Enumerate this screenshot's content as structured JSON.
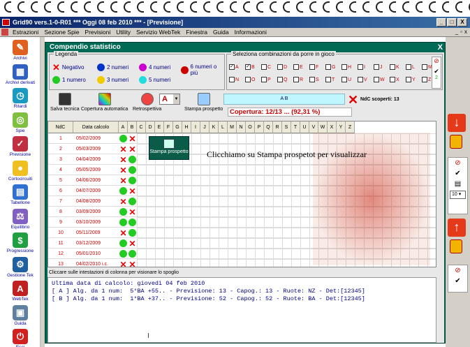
{
  "window": {
    "title": "Grid90 vers.1-0-R01  ***  Oggi 08 feb 2010  ***  - [Previsione]",
    "controls": [
      "_",
      "□",
      "X"
    ]
  },
  "menu": [
    "Estrazioni",
    "Sezione Spie",
    "Previsioni",
    "Utility",
    "Servizio WebTek",
    "Finestra",
    "Guida",
    "Informazioni"
  ],
  "sidebar": [
    {
      "label": "Archivi",
      "icon": "pencil-icon"
    },
    {
      "label": "Archivi derivati",
      "icon": "archive-icon"
    },
    {
      "label": "Ritardi",
      "icon": "clock-icon"
    },
    {
      "label": "Spie",
      "icon": "binoculars-icon"
    },
    {
      "label": "Previsione",
      "icon": "clipboard-icon"
    },
    {
      "label": "Cortocircuiti",
      "icon": "bulb-icon"
    },
    {
      "label": "Tabellone",
      "icon": "calendar-icon"
    },
    {
      "label": "Equilibrio",
      "icon": "scale-icon"
    },
    {
      "label": "Progressione",
      "icon": "dollar-icon"
    },
    {
      "label": "Gestione Tek",
      "icon": "tools-icon"
    },
    {
      "label": "WebTek",
      "icon": "webtek-icon"
    },
    {
      "label": "Guida",
      "icon": "book-icon"
    },
    {
      "label": "Esci",
      "icon": "exit-icon"
    }
  ],
  "dialog": {
    "title": "Compendio statistico",
    "close": "X",
    "legend_title": "Legenda",
    "legend": [
      {
        "label": "Negativo",
        "color": "#e00000",
        "shape": "x"
      },
      {
        "label": "2 numeri",
        "color": "#0033cc",
        "shape": "dot"
      },
      {
        "label": "4 numeri",
        "color": "#cc00cc",
        "shape": "dot"
      },
      {
        "label": "6 numeri o più",
        "color": "#cc0000",
        "shape": "dot"
      },
      {
        "label": "1 numero",
        "color": "#22cc22",
        "shape": "dot"
      },
      {
        "label": "3 numeri",
        "color": "#eecc00",
        "shape": "dot"
      },
      {
        "label": "5 numeri",
        "color": "#22dddd",
        "shape": "dot"
      }
    ],
    "combo_title": "Seleziona combinazioni da porre in gioco",
    "combo_row1": [
      "A",
      "B",
      "C",
      "D",
      "E",
      "F",
      "G",
      "H",
      "I",
      "J",
      "K",
      "L",
      "M"
    ],
    "combo_row2": [
      "N",
      "O",
      "P",
      "Q",
      "R",
      "S",
      "T",
      "U",
      "V",
      "W",
      "X",
      "Y",
      "Z"
    ],
    "combo_checked": [
      "A",
      "B"
    ],
    "combo_side_count": "2",
    "toolbar": [
      {
        "label": "Salva tecnica",
        "icon": "save-icon"
      },
      {
        "label": "Copertura automatica",
        "icon": "grid-icon"
      },
      {
        "label": "Retrospettiva",
        "icon": "refresh-icon"
      },
      {
        "label": "Stampa prospetto",
        "icon": "print-icon"
      }
    ],
    "combo_select_value": "A",
    "ab_label": "A B",
    "copertura": "Copertura: 12/13 ... (92,31 %)",
    "ndc_scoperti": "NdC scoperti: 13",
    "columns": {
      "ndc": "NdC",
      "date": "Data calcolo",
      "letters": [
        "A",
        "B",
        "C",
        "D",
        "E",
        "F",
        "G",
        "H",
        "I",
        "J",
        "K",
        "L",
        "M",
        "N",
        "O",
        "P",
        "Q",
        "R",
        "S",
        "T",
        "U",
        "V",
        "W",
        "X",
        "Y",
        "Z"
      ]
    },
    "rows": [
      {
        "ndc": "1",
        "date": "05/02/2009",
        "a": "dot",
        "b": "x"
      },
      {
        "ndc": "2",
        "date": "05/03/2009",
        "a": "x",
        "b": "x"
      },
      {
        "ndc": "3",
        "date": "04/04/2009",
        "a": "x",
        "b": "dot"
      },
      {
        "ndc": "4",
        "date": "05/05/2009",
        "a": "x",
        "b": "dot"
      },
      {
        "ndc": "5",
        "date": "04/06/2009",
        "a": "x",
        "b": "dot"
      },
      {
        "ndc": "6",
        "date": "04/07/2009",
        "a": "dot",
        "b": "x"
      },
      {
        "ndc": "7",
        "date": "04/08/2009",
        "a": "x",
        "b": "dot"
      },
      {
        "ndc": "8",
        "date": "03/09/2009",
        "a": "dot",
        "b": "x"
      },
      {
        "ndc": "9",
        "date": "03/10/2009",
        "a": "dot",
        "b": "dot"
      },
      {
        "ndc": "10",
        "date": "05/11/2009",
        "a": "x",
        "b": "dot"
      },
      {
        "ndc": "11",
        "date": "03/12/2009",
        "a": "dot",
        "b": "x"
      },
      {
        "ndc": "12",
        "date": "05/01/2010",
        "a": "dot",
        "b": "dot"
      },
      {
        "ndc": "13",
        "date": "04/02/2010 i.c.",
        "a": "x",
        "b": "x"
      }
    ],
    "overlay_label": "Stampa prospetto",
    "hint": "Clicchiamo su Stampa prospetot per visualizzar",
    "help_text": "Cliccare sulle intestazioni di colonna per visionare lo spoglio",
    "output": [
      "Ultima data di calcolo: giovedì 04 feb 2010",
      "",
      "[ A ] Alg. da 1 num:  5°BA +55.. - Previsione: 13 - Capog.: 13 - Ruote: NZ - Det:[12345]",
      "[ B ] Alg. da 1 num:  1°BA +37.. - Previsione: 52 - Capog.: 52 - Ruote: BA - Det:[12345]"
    ]
  },
  "rightpanel": {
    "select_value": "10"
  }
}
